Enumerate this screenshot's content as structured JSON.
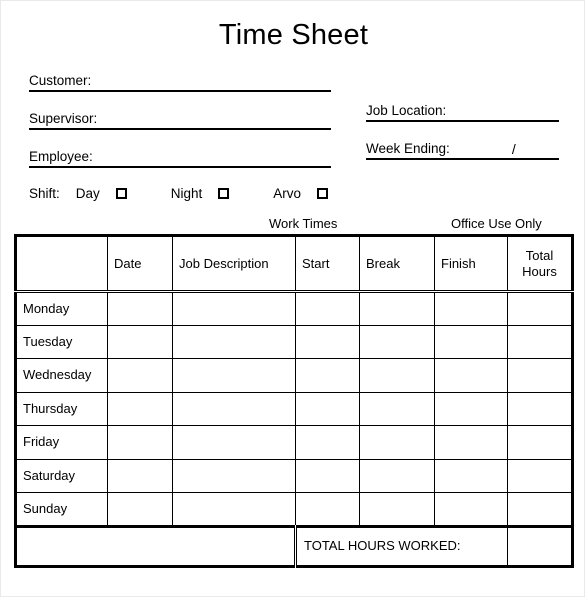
{
  "document": {
    "title": "Time Sheet"
  },
  "form": {
    "left_fields": [
      {
        "label": "Customer:",
        "value": ""
      },
      {
        "label": "Supervisor:",
        "value": ""
      },
      {
        "label": "Employee:",
        "value": ""
      }
    ],
    "right_fields": [
      {
        "label": "Job Location:",
        "value": ""
      },
      {
        "label": "Week Ending:",
        "value": "",
        "separator": "/"
      }
    ],
    "shift": {
      "label": "Shift:",
      "options": [
        {
          "label": "Day",
          "checked": false
        },
        {
          "label": "Night",
          "checked": false
        },
        {
          "label": "Arvo",
          "checked": false
        }
      ]
    }
  },
  "group_labels": {
    "work_times": "Work Times",
    "office_use_only": "Office Use Only"
  },
  "table": {
    "headers": [
      "",
      "Date",
      "Job Description",
      "Start",
      "Break",
      "Finish",
      "Total Hours"
    ],
    "header_total_line1": "Total",
    "header_total_line2": "Hours",
    "rows": [
      {
        "day": "Monday",
        "date": "",
        "job_description": "",
        "start": "",
        "break": "",
        "finish": "",
        "total_hours": ""
      },
      {
        "day": "Tuesday",
        "date": "",
        "job_description": "",
        "start": "",
        "break": "",
        "finish": "",
        "total_hours": ""
      },
      {
        "day": "Wednesday",
        "date": "",
        "job_description": "",
        "start": "",
        "break": "",
        "finish": "",
        "total_hours": ""
      },
      {
        "day": "Thursday",
        "date": "",
        "job_description": "",
        "start": "",
        "break": "",
        "finish": "",
        "total_hours": ""
      },
      {
        "day": "Friday",
        "date": "",
        "job_description": "",
        "start": "",
        "break": "",
        "finish": "",
        "total_hours": ""
      },
      {
        "day": "Saturday",
        "date": "",
        "job_description": "",
        "start": "",
        "break": "",
        "finish": "",
        "total_hours": ""
      },
      {
        "day": "Sunday",
        "date": "",
        "job_description": "",
        "start": "",
        "break": "",
        "finish": "",
        "total_hours": ""
      }
    ],
    "footer": {
      "label": "TOTAL HOURS WORKED:",
      "value": ""
    }
  },
  "colors": {
    "ink": "#000000",
    "paper": "#ffffff",
    "page_border": "#e9e9e9"
  }
}
